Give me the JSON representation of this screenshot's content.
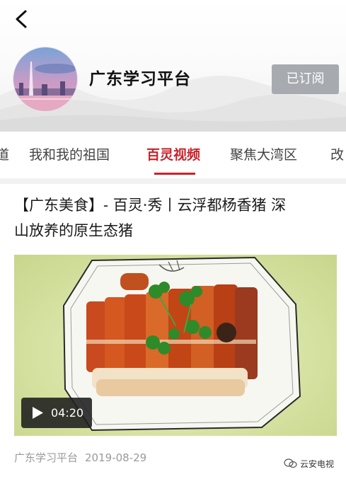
{
  "header": {
    "channel_name": "广东学习平台",
    "subscribe_label": "已订阅"
  },
  "tabs": [
    {
      "label": "道"
    },
    {
      "label": "我和我的祖国"
    },
    {
      "label": "百灵视频"
    },
    {
      "label": "聚焦大湾区"
    },
    {
      "label": "改"
    }
  ],
  "active_tab": "百灵视频",
  "article": {
    "title_line1": "【广东美食】- 百灵·秀丨云浮都杨香猪 深",
    "title_line2": "山放养的原生态猪",
    "video_duration": "04:20",
    "source": "广东学习平台",
    "date": "2019-08-29"
  },
  "watermark": {
    "text": "云安电视"
  },
  "colors": {
    "accent": "#c8232b",
    "subscribe_bg": "#a7abb0",
    "meta_text": "#9a9a9a"
  },
  "icons": [
    "back-arrow-icon",
    "play-icon",
    "wechat-icon"
  ]
}
